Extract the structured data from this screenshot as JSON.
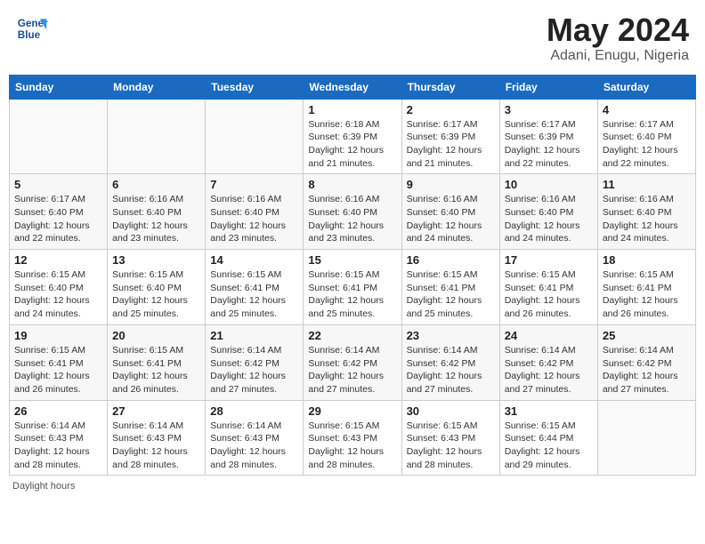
{
  "header": {
    "logo_line1": "General",
    "logo_line2": "Blue",
    "title": "May 2024",
    "subtitle": "Adani, Enugu, Nigeria"
  },
  "days_of_week": [
    "Sunday",
    "Monday",
    "Tuesday",
    "Wednesday",
    "Thursday",
    "Friday",
    "Saturday"
  ],
  "footer": {
    "daylight_label": "Daylight hours"
  },
  "weeks": [
    [
      {
        "num": "",
        "info": ""
      },
      {
        "num": "",
        "info": ""
      },
      {
        "num": "",
        "info": ""
      },
      {
        "num": "1",
        "info": "Sunrise: 6:18 AM\nSunset: 6:39 PM\nDaylight: 12 hours and 21 minutes."
      },
      {
        "num": "2",
        "info": "Sunrise: 6:17 AM\nSunset: 6:39 PM\nDaylight: 12 hours and 21 minutes."
      },
      {
        "num": "3",
        "info": "Sunrise: 6:17 AM\nSunset: 6:39 PM\nDaylight: 12 hours and 22 minutes."
      },
      {
        "num": "4",
        "info": "Sunrise: 6:17 AM\nSunset: 6:40 PM\nDaylight: 12 hours and 22 minutes."
      }
    ],
    [
      {
        "num": "5",
        "info": "Sunrise: 6:17 AM\nSunset: 6:40 PM\nDaylight: 12 hours and 22 minutes."
      },
      {
        "num": "6",
        "info": "Sunrise: 6:16 AM\nSunset: 6:40 PM\nDaylight: 12 hours and 23 minutes."
      },
      {
        "num": "7",
        "info": "Sunrise: 6:16 AM\nSunset: 6:40 PM\nDaylight: 12 hours and 23 minutes."
      },
      {
        "num": "8",
        "info": "Sunrise: 6:16 AM\nSunset: 6:40 PM\nDaylight: 12 hours and 23 minutes."
      },
      {
        "num": "9",
        "info": "Sunrise: 6:16 AM\nSunset: 6:40 PM\nDaylight: 12 hours and 24 minutes."
      },
      {
        "num": "10",
        "info": "Sunrise: 6:16 AM\nSunset: 6:40 PM\nDaylight: 12 hours and 24 minutes."
      },
      {
        "num": "11",
        "info": "Sunrise: 6:16 AM\nSunset: 6:40 PM\nDaylight: 12 hours and 24 minutes."
      }
    ],
    [
      {
        "num": "12",
        "info": "Sunrise: 6:15 AM\nSunset: 6:40 PM\nDaylight: 12 hours and 24 minutes."
      },
      {
        "num": "13",
        "info": "Sunrise: 6:15 AM\nSunset: 6:40 PM\nDaylight: 12 hours and 25 minutes."
      },
      {
        "num": "14",
        "info": "Sunrise: 6:15 AM\nSunset: 6:41 PM\nDaylight: 12 hours and 25 minutes."
      },
      {
        "num": "15",
        "info": "Sunrise: 6:15 AM\nSunset: 6:41 PM\nDaylight: 12 hours and 25 minutes."
      },
      {
        "num": "16",
        "info": "Sunrise: 6:15 AM\nSunset: 6:41 PM\nDaylight: 12 hours and 25 minutes."
      },
      {
        "num": "17",
        "info": "Sunrise: 6:15 AM\nSunset: 6:41 PM\nDaylight: 12 hours and 26 minutes."
      },
      {
        "num": "18",
        "info": "Sunrise: 6:15 AM\nSunset: 6:41 PM\nDaylight: 12 hours and 26 minutes."
      }
    ],
    [
      {
        "num": "19",
        "info": "Sunrise: 6:15 AM\nSunset: 6:41 PM\nDaylight: 12 hours and 26 minutes."
      },
      {
        "num": "20",
        "info": "Sunrise: 6:15 AM\nSunset: 6:41 PM\nDaylight: 12 hours and 26 minutes."
      },
      {
        "num": "21",
        "info": "Sunrise: 6:14 AM\nSunset: 6:42 PM\nDaylight: 12 hours and 27 minutes."
      },
      {
        "num": "22",
        "info": "Sunrise: 6:14 AM\nSunset: 6:42 PM\nDaylight: 12 hours and 27 minutes."
      },
      {
        "num": "23",
        "info": "Sunrise: 6:14 AM\nSunset: 6:42 PM\nDaylight: 12 hours and 27 minutes."
      },
      {
        "num": "24",
        "info": "Sunrise: 6:14 AM\nSunset: 6:42 PM\nDaylight: 12 hours and 27 minutes."
      },
      {
        "num": "25",
        "info": "Sunrise: 6:14 AM\nSunset: 6:42 PM\nDaylight: 12 hours and 27 minutes."
      }
    ],
    [
      {
        "num": "26",
        "info": "Sunrise: 6:14 AM\nSunset: 6:43 PM\nDaylight: 12 hours and 28 minutes."
      },
      {
        "num": "27",
        "info": "Sunrise: 6:14 AM\nSunset: 6:43 PM\nDaylight: 12 hours and 28 minutes."
      },
      {
        "num": "28",
        "info": "Sunrise: 6:14 AM\nSunset: 6:43 PM\nDaylight: 12 hours and 28 minutes."
      },
      {
        "num": "29",
        "info": "Sunrise: 6:15 AM\nSunset: 6:43 PM\nDaylight: 12 hours and 28 minutes."
      },
      {
        "num": "30",
        "info": "Sunrise: 6:15 AM\nSunset: 6:43 PM\nDaylight: 12 hours and 28 minutes."
      },
      {
        "num": "31",
        "info": "Sunrise: 6:15 AM\nSunset: 6:44 PM\nDaylight: 12 hours and 29 minutes."
      },
      {
        "num": "",
        "info": ""
      }
    ]
  ]
}
